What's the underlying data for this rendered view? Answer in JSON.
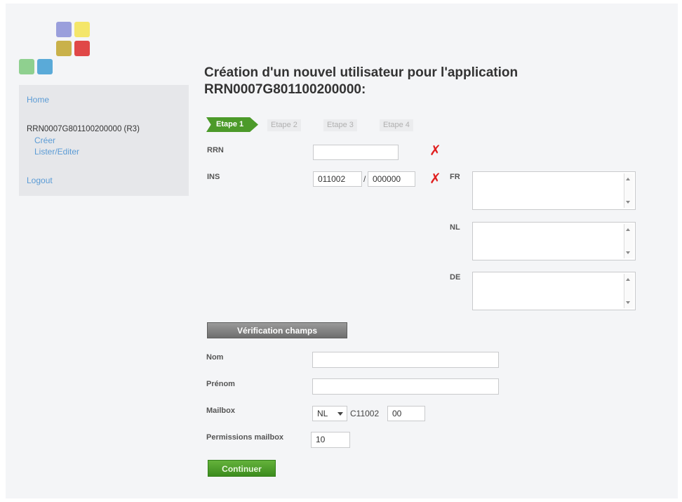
{
  "logo": {
    "colors": [
      "#9a9fdc",
      "#f4e66a",
      "#c9b14a",
      "#e04848",
      "#8fd08f",
      "#5aaad8"
    ]
  },
  "sidebar": {
    "home": "Home",
    "app_name": "RRN0007G801100200000 (R3)",
    "create": "Créer",
    "list_edit": "Lister/Editer",
    "logout": "Logout"
  },
  "title": "Création d'un nouvel utilisateur pour l'application RRN0007G801100200000:",
  "steps": [
    "Etape 1",
    "Etape 2",
    "Etape 3",
    "Etape 4"
  ],
  "form": {
    "rrn_label": "RRN",
    "rrn_value": "",
    "ins_label": "INS",
    "ins_value1": "011002",
    "ins_separator": "/",
    "ins_value2": "000000",
    "fr_label": "FR",
    "nl_label": "NL",
    "de_label": "DE",
    "verify_button": "Vérification champs",
    "nom_label": "Nom",
    "nom_value": "",
    "prenom_label": "Prénom",
    "prenom_value": "",
    "mailbox_label": "Mailbox",
    "mailbox_lang": "NL",
    "mailbox_prefix": "C11002",
    "mailbox_suffix": "00",
    "permissions_label": "Permissions mailbox",
    "permissions_value": "10",
    "continue_button": "Continuer"
  },
  "colors": {
    "accent_green": "#4c9a2a",
    "error_red": "#e02020",
    "link_blue": "#5b9bd5"
  }
}
